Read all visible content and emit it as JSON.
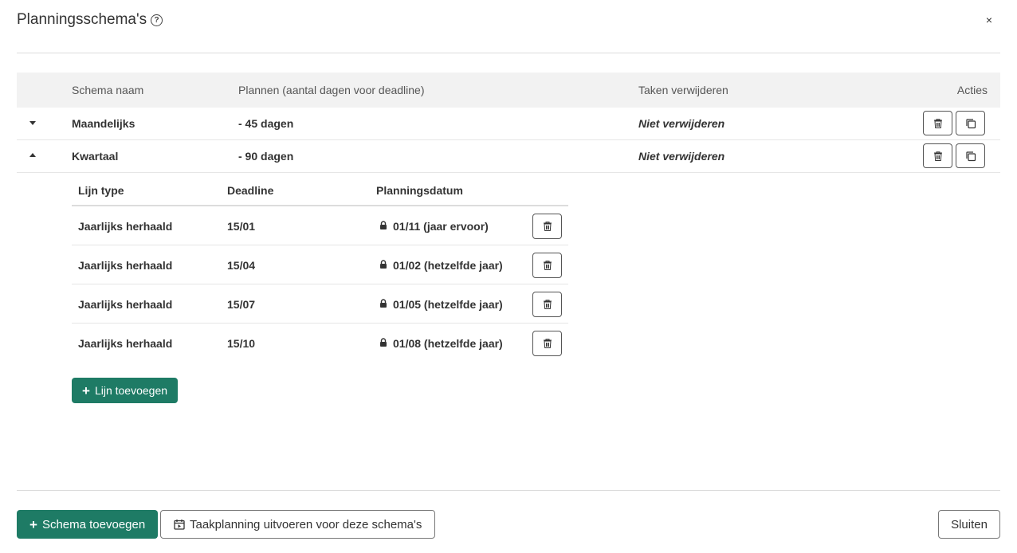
{
  "modal": {
    "title": "Planningsschema's",
    "close": "×"
  },
  "table": {
    "headers": {
      "name": "Schema naam",
      "plan": "Plannen (aantal dagen voor deadline)",
      "delete": "Taken verwijderen",
      "actions": "Acties"
    },
    "rows": [
      {
        "name": "Maandelijks",
        "plan": "- 45 dagen",
        "delete": "Niet verwijderen",
        "expanded": false
      },
      {
        "name": "Kwartaal",
        "plan": "- 90 dagen",
        "delete": "Niet verwijderen",
        "expanded": true
      }
    ]
  },
  "subtable": {
    "headers": {
      "type": "Lijn type",
      "deadline": "Deadline",
      "date": "Planningsdatum"
    },
    "rows": [
      {
        "type": "Jaarlijks herhaald",
        "deadline": "15/01",
        "date": "01/11 (jaar ervoor)"
      },
      {
        "type": "Jaarlijks herhaald",
        "deadline": "15/04",
        "date": "01/02 (hetzelfde jaar)"
      },
      {
        "type": "Jaarlijks herhaald",
        "deadline": "15/07",
        "date": "01/05 (hetzelfde jaar)"
      },
      {
        "type": "Jaarlijks herhaald",
        "deadline": "15/10",
        "date": "01/08 (hetzelfde jaar)"
      }
    ],
    "add_label": "Lijn toevoegen"
  },
  "footer": {
    "add_schema": "Schema toevoegen",
    "run_planning": "Taakplanning uitvoeren voor deze schema's",
    "close": "Sluiten"
  },
  "colors": {
    "primary": "#1e7b65"
  },
  "icons": [
    "help-icon",
    "close-icon",
    "caret-down-icon",
    "caret-up-icon",
    "trash-icon",
    "copy-icon",
    "lock-icon",
    "plus-icon",
    "calendar-play-icon"
  ]
}
